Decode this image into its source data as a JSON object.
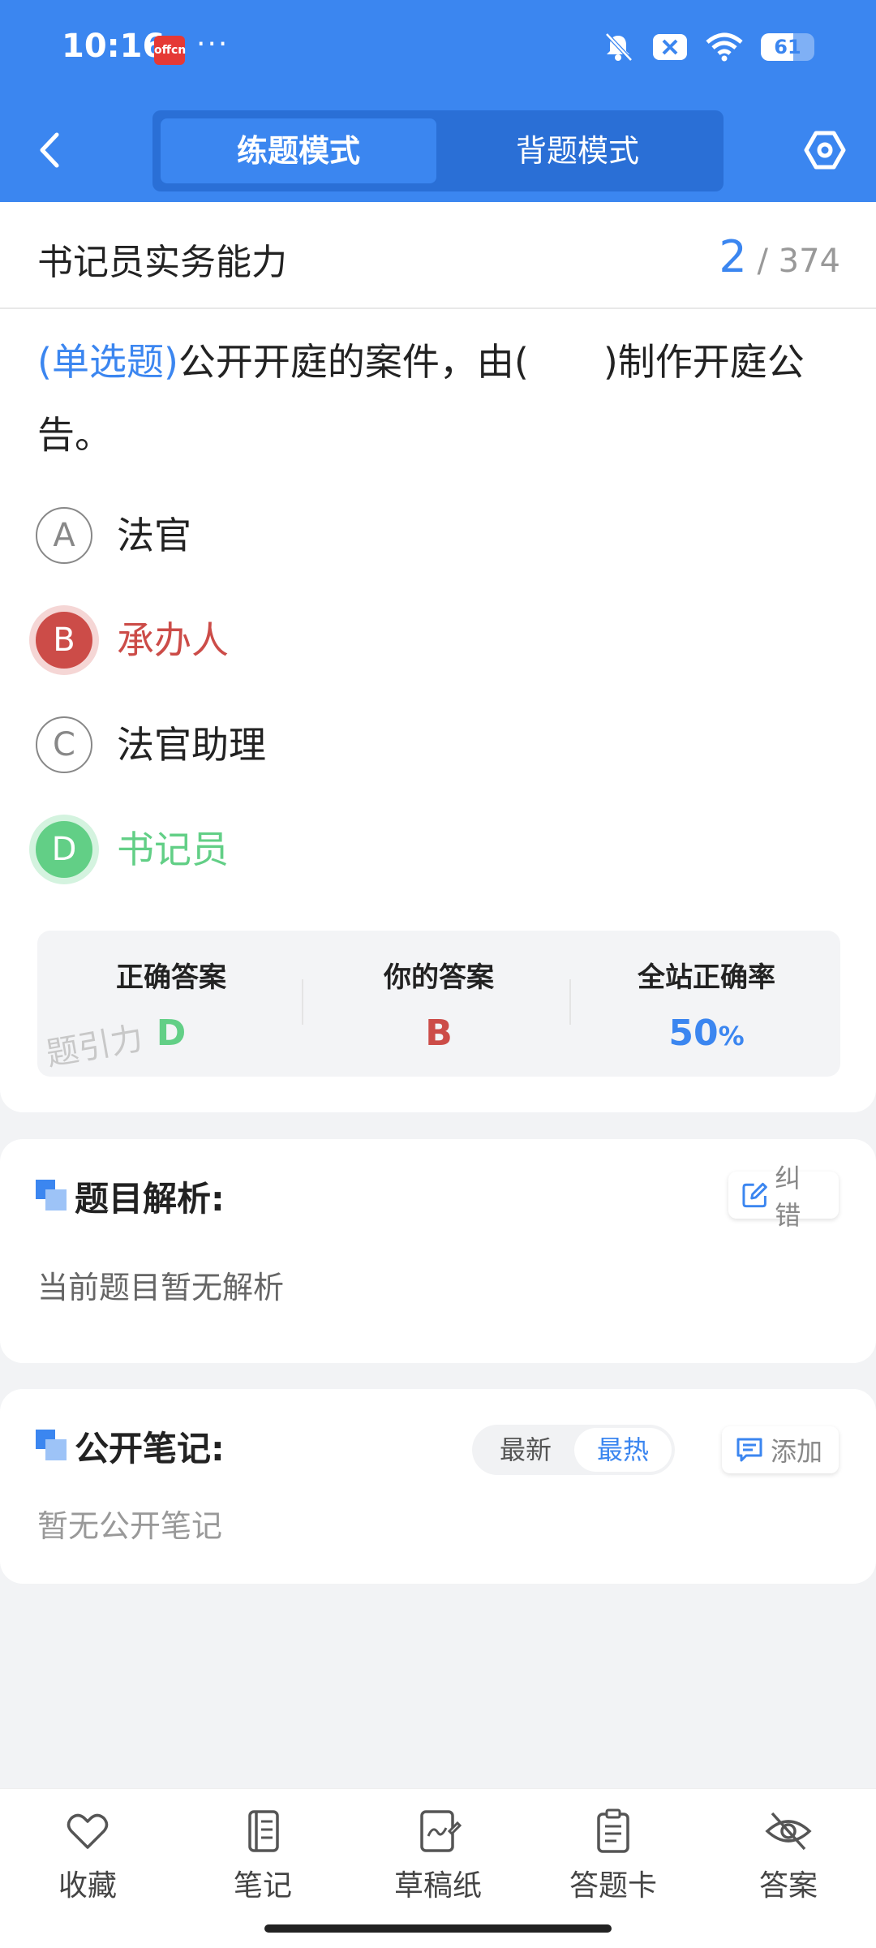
{
  "status_bar": {
    "time": "10:16",
    "app_logo_text": "offcn",
    "more": "···",
    "battery": "61",
    "battery_level": 0.61
  },
  "header": {
    "tabs": [
      {
        "label": "练题模式",
        "active": true
      },
      {
        "label": "背题模式",
        "active": false
      }
    ]
  },
  "subject": {
    "title": "书记员实务能力",
    "current": "2",
    "total": "/ 374"
  },
  "question": {
    "type": "(单选题)",
    "text": "公开开庭的案件，由(　　)制作开庭公告。",
    "options": [
      {
        "letter": "A",
        "text": "法官",
        "state": "normal"
      },
      {
        "letter": "B",
        "text": "承办人",
        "state": "wrong"
      },
      {
        "letter": "C",
        "text": "法官助理",
        "state": "normal"
      },
      {
        "letter": "D",
        "text": "书记员",
        "state": "right"
      }
    ]
  },
  "result": {
    "correct_label": "正确答案",
    "correct_value": "D",
    "yours_label": "你的答案",
    "yours_value": "B",
    "rate_label": "全站正确率",
    "rate_value": "50",
    "rate_unit": "%",
    "watermark": "题引力"
  },
  "analysis": {
    "title": "题目解析:",
    "report_label": "纠错",
    "body": "当前题目暂无解析"
  },
  "notes": {
    "title": "公开笔记:",
    "sort_latest": "最新",
    "sort_hot": "最热",
    "add_label": "添加",
    "body": "暂无公开笔记"
  },
  "bottom_nav": [
    {
      "label": "收藏",
      "icon": "heart-icon"
    },
    {
      "label": "笔记",
      "icon": "notebook-icon"
    },
    {
      "label": "草稿纸",
      "icon": "draft-icon"
    },
    {
      "label": "答题卡",
      "icon": "answer-sheet-icon"
    },
    {
      "label": "答案",
      "icon": "eye-off-icon"
    }
  ],
  "colors": {
    "primary": "#3b86f0",
    "wrong": "#cc4c48",
    "right": "#62cf86"
  }
}
